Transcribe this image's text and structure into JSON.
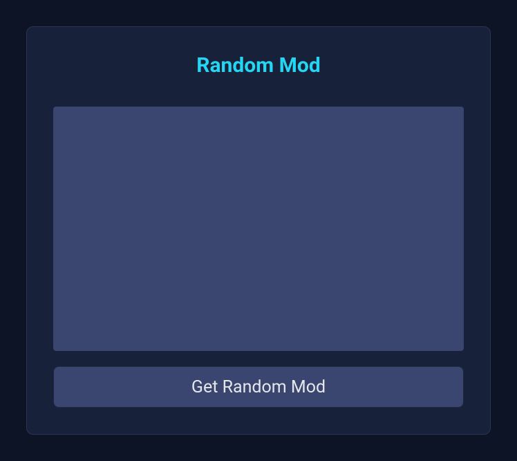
{
  "card": {
    "title": "Random Mod",
    "button_label": "Get Random Mod"
  }
}
